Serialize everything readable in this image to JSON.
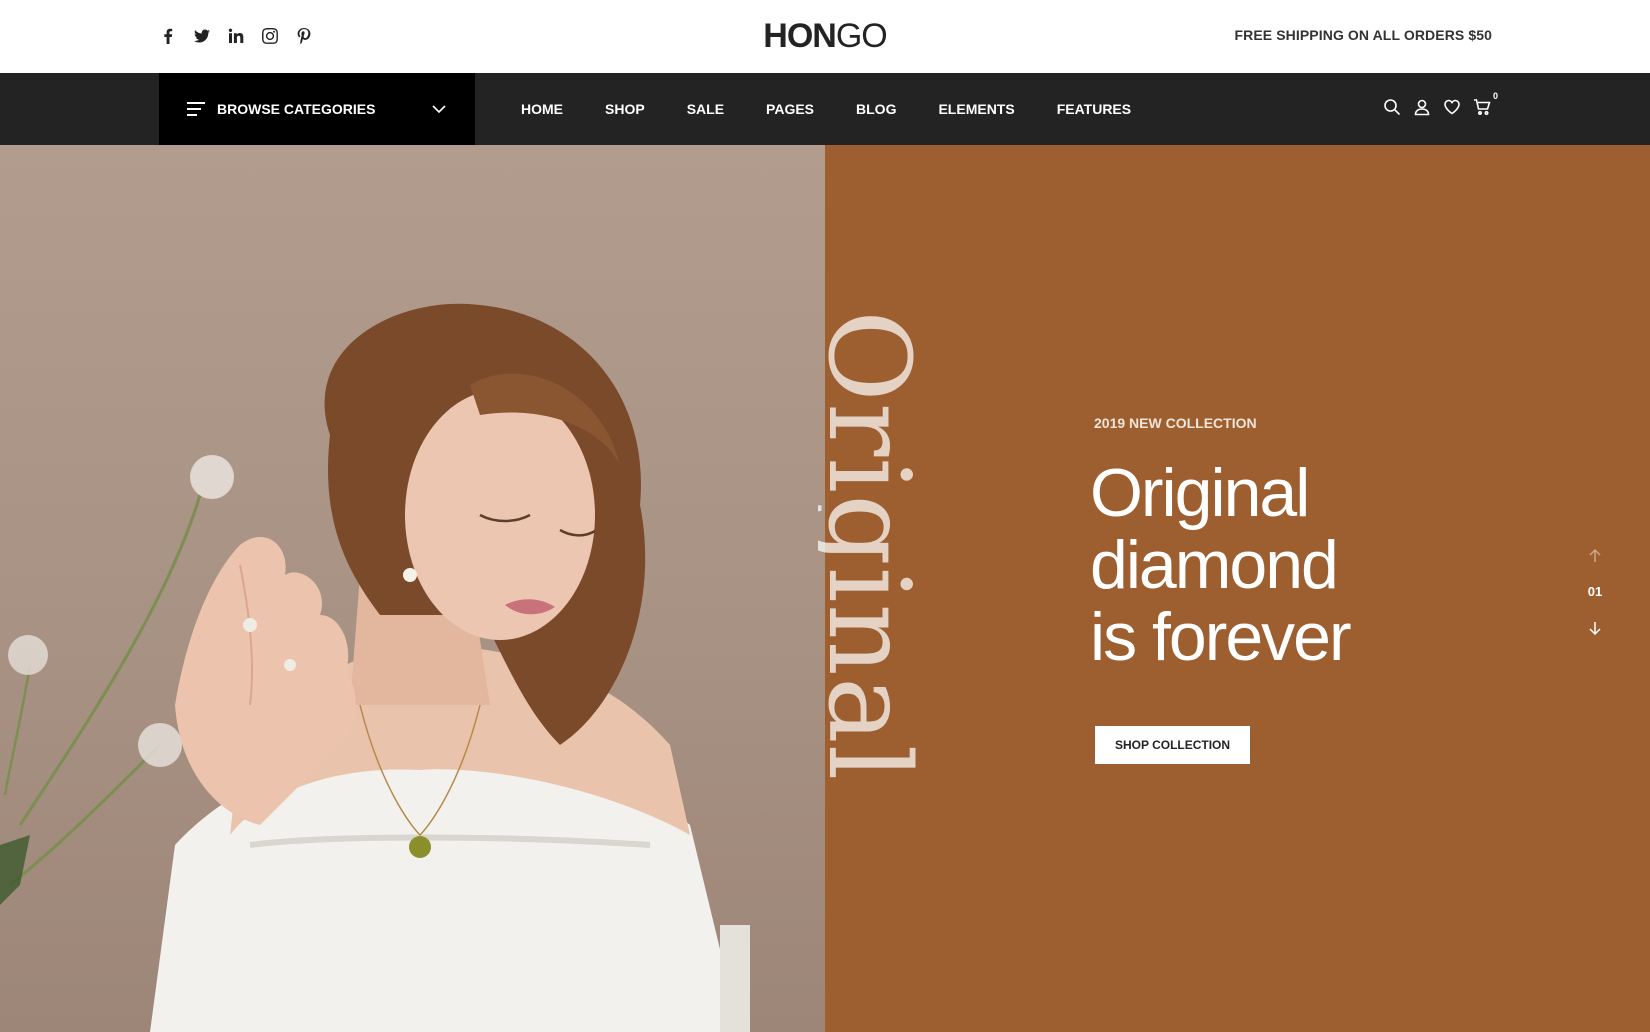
{
  "topbar": {
    "social": [
      {
        "name": "facebook-icon"
      },
      {
        "name": "twitter-icon"
      },
      {
        "name": "linkedin-icon"
      },
      {
        "name": "instagram-icon"
      },
      {
        "name": "pinterest-icon"
      }
    ],
    "logo_bold": "HON",
    "logo_light": "GO",
    "shipping": "FREE SHIPPING ON ALL ORDERS $50"
  },
  "nav": {
    "browse_label": "BROWSE CATEGORIES",
    "items": [
      "HOME",
      "SHOP",
      "SALE",
      "PAGES",
      "BLOG",
      "ELEMENTS",
      "FEATURES"
    ],
    "icons": [
      "search-icon",
      "user-icon",
      "heart-icon",
      "cart-icon"
    ],
    "cart_count": "0"
  },
  "hero": {
    "vertical_word": "Original",
    "eyebrow": "2019 NEW COLLECTION",
    "headline": [
      "Original",
      "diamond",
      "is forever"
    ],
    "button": "SHOP COLLECTION",
    "slide_number": "01",
    "colors": {
      "left_bg": "#a89284",
      "right_bg": "#9e5f30"
    }
  }
}
